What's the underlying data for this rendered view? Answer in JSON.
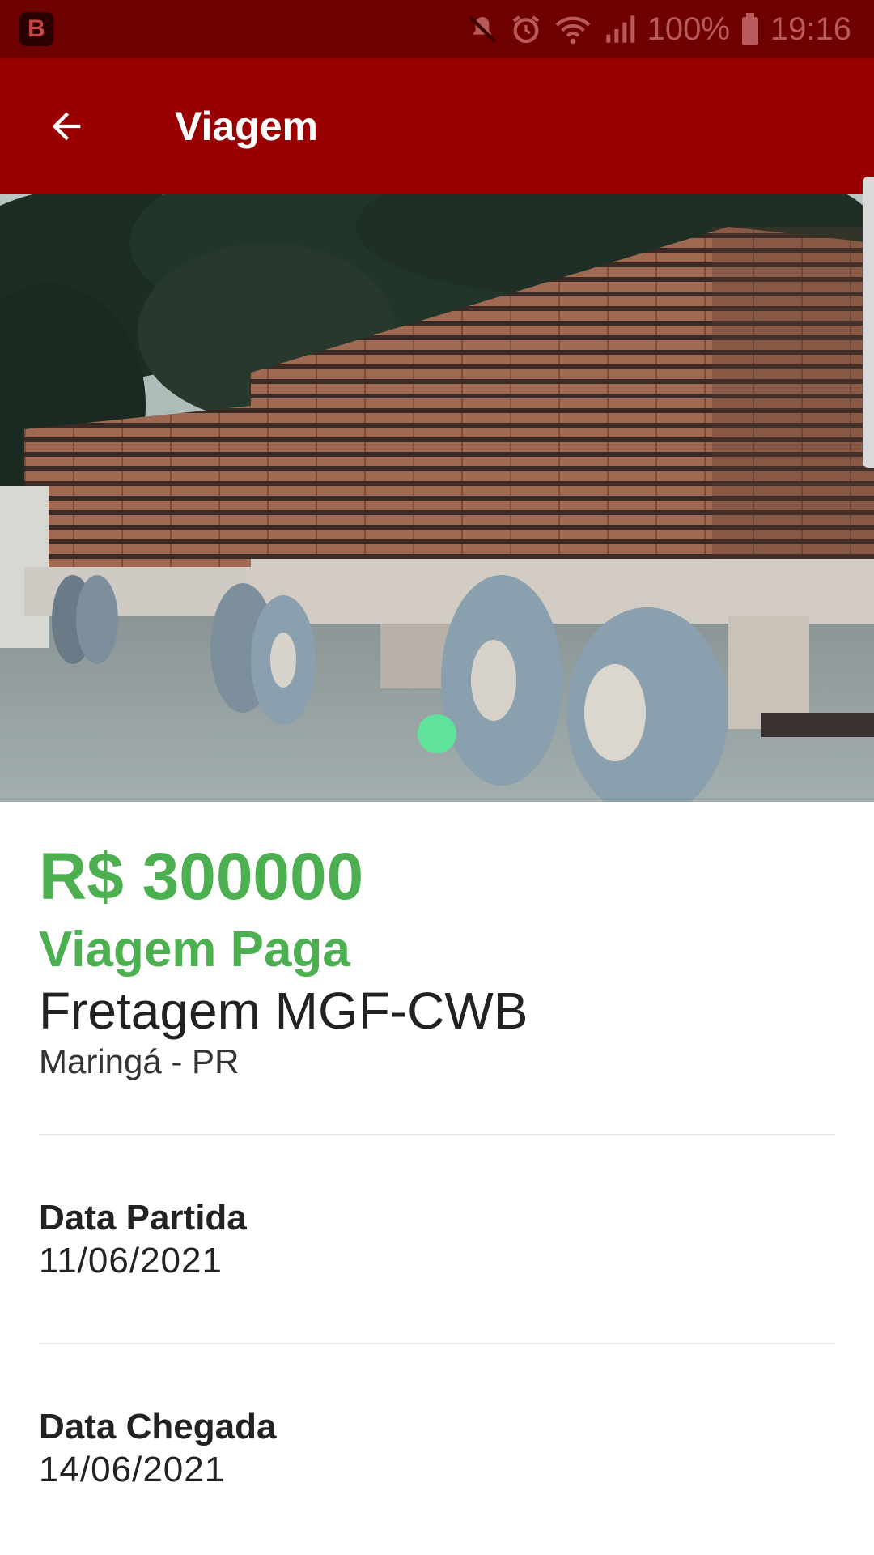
{
  "status_bar": {
    "app_icon": "B",
    "icons": [
      "mute-icon",
      "alarm-icon",
      "wifi-icon",
      "signal-icon",
      "battery-icon"
    ],
    "battery": "100%",
    "time": "19:16"
  },
  "app_bar": {
    "back_icon": "arrow-left-icon",
    "title": "Viagem"
  },
  "carousel": {
    "image": "truck-with-lumber-photo",
    "page_count": 1,
    "active_page": 1
  },
  "trip": {
    "price": "R$ 300000",
    "status": "Viagem Paga",
    "name": "Fretagem MGF-CWB",
    "location": "Maringá - PR"
  },
  "fields": {
    "departure_label": "Data Partida",
    "departure_value": "11/06/2021",
    "arrival_label": "Data Chegada",
    "arrival_value": "14/06/2021"
  },
  "colors": {
    "status_bar": "#6e0000",
    "app_bar": "#990000",
    "accent_green": "#4caf50",
    "page_dot": "#5fe39a"
  }
}
